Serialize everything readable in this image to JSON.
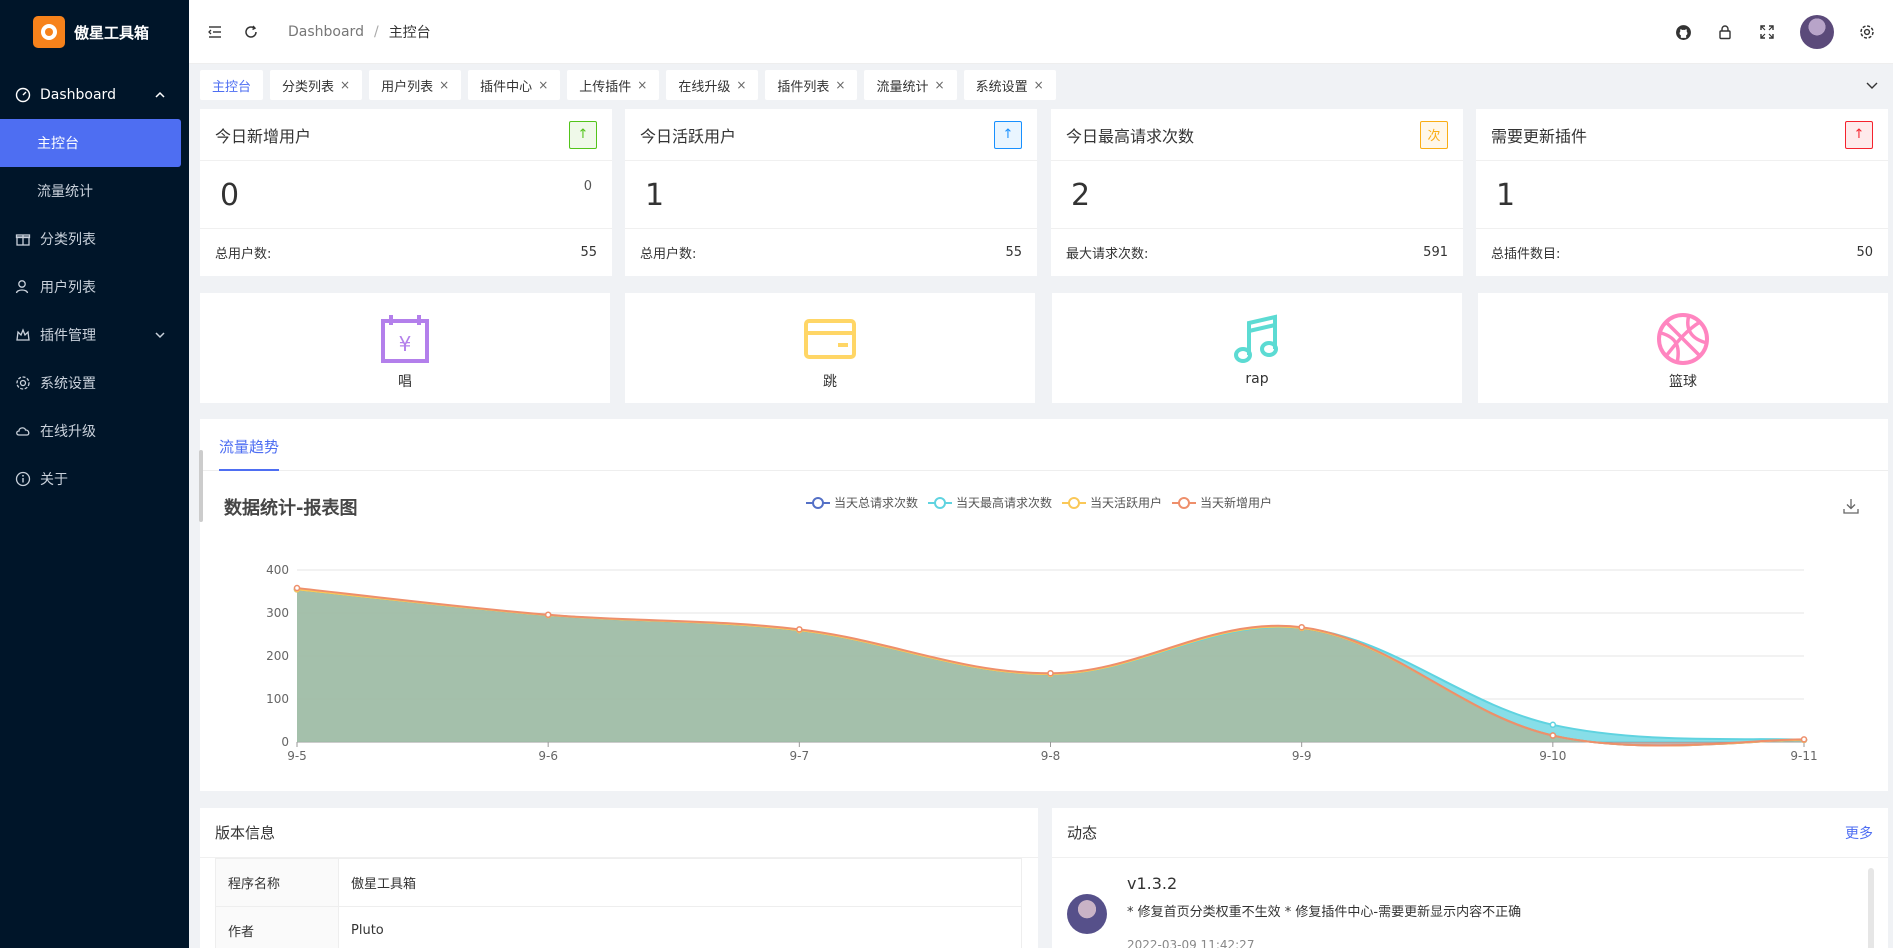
{
  "app": {
    "title": "傲星工具箱"
  },
  "sidebar": {
    "items": [
      {
        "label": "Dashboard",
        "icon": "dashboard-icon"
      },
      {
        "label": "主控台"
      },
      {
        "label": "流量统计"
      },
      {
        "label": "分类列表",
        "icon": "gift-icon"
      },
      {
        "label": "用户列表",
        "icon": "user-icon"
      },
      {
        "label": "插件管理",
        "icon": "plugin-icon"
      },
      {
        "label": "系统设置",
        "icon": "gear-icon"
      },
      {
        "label": "在线升级",
        "icon": "cloud-icon"
      },
      {
        "label": "关于",
        "icon": "info-icon"
      }
    ]
  },
  "header": {
    "breadcrumb_home": "Dashboard",
    "breadcrumb_sep": "/",
    "breadcrumb_current": "主控台"
  },
  "tabs": [
    {
      "label": "主控台",
      "active": true,
      "closable": false
    },
    {
      "label": "分类列表",
      "closable": true
    },
    {
      "label": "用户列表",
      "closable": true
    },
    {
      "label": "插件中心",
      "closable": true
    },
    {
      "label": "上传插件",
      "closable": true
    },
    {
      "label": "在线升级",
      "closable": true
    },
    {
      "label": "插件列表",
      "closable": true
    },
    {
      "label": "流量统计",
      "closable": true
    },
    {
      "label": "系统设置",
      "closable": true
    }
  ],
  "tab_close": "×",
  "stats": [
    {
      "title": "今日新增用户",
      "badge": "↑",
      "badge_color": "#52c41a",
      "value": "0",
      "small": "0",
      "foot_label": "总用户数:",
      "foot_value": "55"
    },
    {
      "title": "今日活跃用户",
      "badge": "↑",
      "badge_color": "#1890ff",
      "value": "1",
      "small": "",
      "foot_label": "总用户数:",
      "foot_value": "55"
    },
    {
      "title": "今日最高请求次数",
      "badge": "次",
      "badge_color": "#faad14",
      "value": "2",
      "small": "",
      "foot_label": "最大请求次数:",
      "foot_value": "591"
    },
    {
      "title": "需要更新插件",
      "badge": "↑",
      "badge_color": "#f5222d",
      "value": "1",
      "small": "",
      "foot_label": "总插件数目:",
      "foot_value": "50"
    }
  ],
  "quick": [
    {
      "label": "唱",
      "icon": "calendar-yen-icon",
      "color": "#b37feb"
    },
    {
      "label": "跳",
      "icon": "card-icon",
      "color": "#ffd666"
    },
    {
      "label": "rap",
      "icon": "music-icon",
      "color": "#5cdbd3"
    },
    {
      "label": "篮球",
      "icon": "basketball-icon",
      "color": "#ff85c0"
    }
  ],
  "chart_panel": {
    "tab": "流量趋势",
    "title": "数据统计-报表图"
  },
  "chart_data": {
    "type": "area",
    "title": "数据统计-报表图",
    "categories": [
      "9-5",
      "9-6",
      "9-7",
      "9-8",
      "9-9",
      "9-10",
      "9-11"
    ],
    "ylim": [
      0,
      400
    ],
    "yticks": [
      0,
      100,
      200,
      300,
      400
    ],
    "legend_position": "top-center",
    "grid": true,
    "series": [
      {
        "name": "当天总请求次数",
        "color": "#5470c6",
        "values": [
          355,
          295,
          260,
          158,
          265,
          15,
          5
        ]
      },
      {
        "name": "当天最高请求次数",
        "color": "#5fd3e0",
        "values": [
          355,
          295,
          260,
          158,
          265,
          40,
          5
        ]
      },
      {
        "name": "当天活跃用户",
        "color": "#fac858",
        "values": [
          355,
          295,
          260,
          158,
          265,
          15,
          5
        ]
      },
      {
        "name": "当天新增用户",
        "color": "#ee8f6b",
        "values": [
          358,
          296,
          262,
          160,
          267,
          15,
          6
        ]
      }
    ]
  },
  "version_panel": {
    "title": "版本信息",
    "rows": [
      {
        "key": "程序名称",
        "value": "傲星工具箱"
      },
      {
        "key": "作者",
        "value": "Pluto"
      }
    ]
  },
  "activity_panel": {
    "title": "动态",
    "more": "更多",
    "items": [
      {
        "version": "v1.3.2",
        "desc": "* 修复首页分类权重不生效 * 修复插件中心-需要更新显示内容不正确",
        "time": "2022-03-09 11:42:27"
      }
    ]
  }
}
